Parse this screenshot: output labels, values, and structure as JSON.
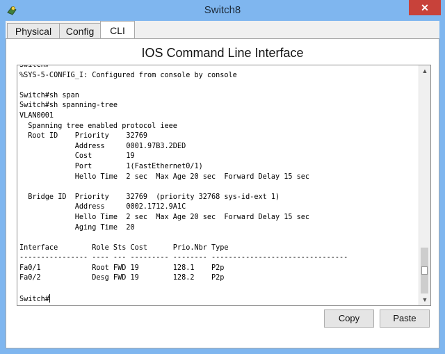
{
  "window": {
    "title": "Switch8",
    "close_symbol": "✕"
  },
  "tabs": [
    {
      "label": "Physical"
    },
    {
      "label": "Config"
    },
    {
      "label": "CLI"
    }
  ],
  "cli": {
    "heading": "IOS Command Line Interface",
    "lines": [
      "Switch#",
      "%SYS-5-CONFIG_I: Configured from console by console",
      "",
      "Switch#sh span",
      "Switch#sh spanning-tree",
      "VLAN0001",
      "  Spanning tree enabled protocol ieee",
      "  Root ID    Priority    32769",
      "             Address     0001.97B3.2DED",
      "             Cost        19",
      "             Port        1(FastEthernet0/1)",
      "             Hello Time  2 sec  Max Age 20 sec  Forward Delay 15 sec",
      "",
      "  Bridge ID  Priority    32769  (priority 32768 sys-id-ext 1)",
      "             Address     0002.1712.9A1C",
      "             Hello Time  2 sec  Max Age 20 sec  Forward Delay 15 sec",
      "             Aging Time  20",
      "",
      "Interface        Role Sts Cost      Prio.Nbr Type",
      "---------------- ---- --- --------- -------- --------------------------------",
      "Fa0/1            Root FWD 19        128.1    P2p",
      "Fa0/2            Desg FWD 19        128.2    P2p",
      "",
      "Switch#"
    ]
  },
  "buttons": {
    "copy": "Copy",
    "paste": "Paste"
  },
  "scrollbar": {
    "up_symbol": "▲",
    "down_symbol": "▼"
  },
  "colors": {
    "title_bar": "#7fb6ef",
    "close_button": "#c8423a"
  }
}
